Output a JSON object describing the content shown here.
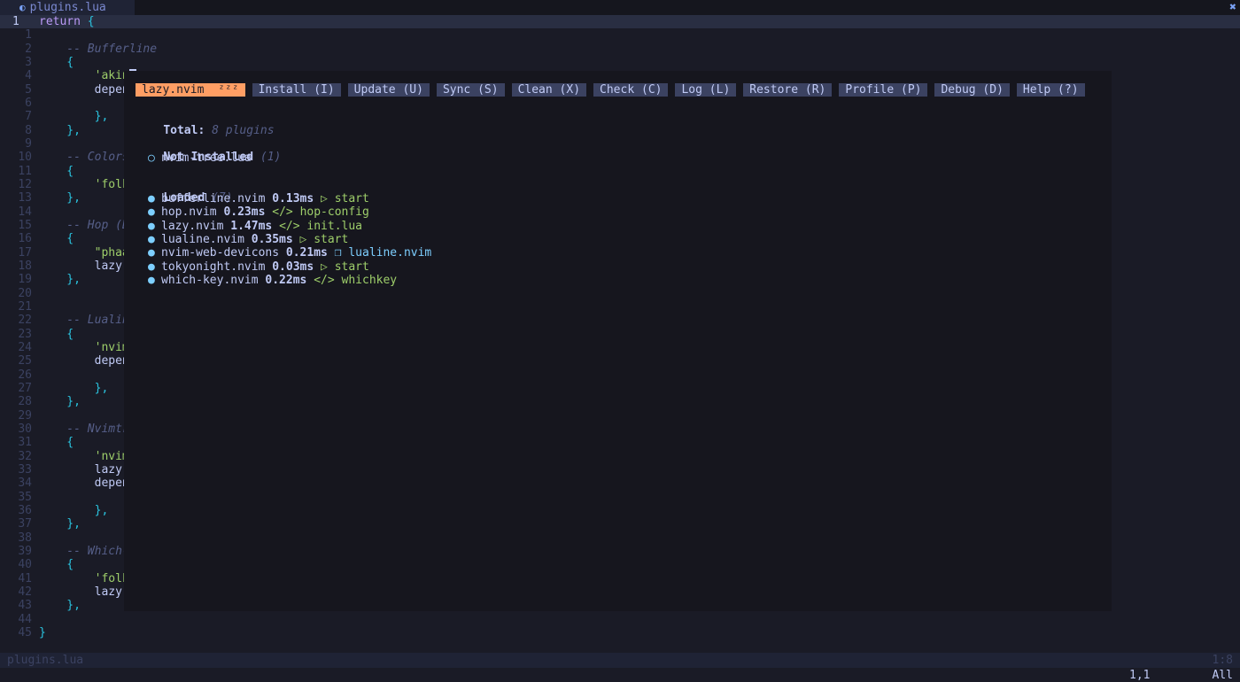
{
  "tabline": {
    "tab_label": "plugins.lua",
    "close_glyph": "✖"
  },
  "editor": {
    "lines": [
      {
        "n": "1",
        "current": true,
        "parts": [
          {
            "c": "kw",
            "t": "return "
          },
          {
            "c": "br",
            "t": "{"
          }
        ]
      },
      {
        "n": "1",
        "parts": []
      },
      {
        "n": "2",
        "parts": [
          {
            "c": "cm",
            "t": "    -- Bufferline"
          }
        ]
      },
      {
        "n": "3",
        "parts": [
          {
            "c": "br",
            "t": "    {"
          }
        ]
      },
      {
        "n": "4",
        "parts": [
          {
            "c": "st",
            "t": "        'akin"
          }
        ],
        "cursor": true
      },
      {
        "n": "5",
        "parts": [
          {
            "c": "tx",
            "t": "        depen"
          }
        ]
      },
      {
        "n": "6",
        "parts": [
          {
            "c": "st",
            "t": "            '"
          }
        ]
      },
      {
        "n": "7",
        "parts": [
          {
            "c": "br",
            "t": "        },"
          }
        ]
      },
      {
        "n": "8",
        "parts": [
          {
            "c": "br",
            "t": "    },"
          }
        ]
      },
      {
        "n": "9",
        "parts": []
      },
      {
        "n": "10",
        "parts": [
          {
            "c": "cm",
            "t": "    -- Colors"
          }
        ]
      },
      {
        "n": "11",
        "parts": [
          {
            "c": "br",
            "t": "    {"
          }
        ]
      },
      {
        "n": "12",
        "parts": [
          {
            "c": "st",
            "t": "        'folk"
          }
        ]
      },
      {
        "n": "13",
        "parts": [
          {
            "c": "br",
            "t": "    },"
          }
        ]
      },
      {
        "n": "14",
        "parts": []
      },
      {
        "n": "15",
        "parts": [
          {
            "c": "cm",
            "t": "    -- Hop (B"
          }
        ]
      },
      {
        "n": "16",
        "parts": [
          {
            "c": "br",
            "t": "    {"
          }
        ]
      },
      {
        "n": "17",
        "parts": [
          {
            "c": "st",
            "t": "        \"phaa"
          }
        ]
      },
      {
        "n": "18",
        "parts": [
          {
            "c": "tx",
            "t": "        lazy"
          }
        ]
      },
      {
        "n": "19",
        "parts": [
          {
            "c": "br",
            "t": "    },"
          }
        ]
      },
      {
        "n": "20",
        "parts": []
      },
      {
        "n": "21",
        "parts": []
      },
      {
        "n": "22",
        "parts": [
          {
            "c": "cm",
            "t": "    -- Lualin"
          }
        ]
      },
      {
        "n": "23",
        "parts": [
          {
            "c": "br",
            "t": "    {"
          }
        ]
      },
      {
        "n": "24",
        "parts": [
          {
            "c": "st",
            "t": "        'nvim"
          }
        ]
      },
      {
        "n": "25",
        "parts": [
          {
            "c": "tx",
            "t": "        depen"
          }
        ]
      },
      {
        "n": "26",
        "parts": [
          {
            "c": "st",
            "t": "            '"
          }
        ]
      },
      {
        "n": "27",
        "parts": [
          {
            "c": "br",
            "t": "        },"
          }
        ]
      },
      {
        "n": "28",
        "parts": [
          {
            "c": "br",
            "t": "    },"
          }
        ]
      },
      {
        "n": "29",
        "parts": []
      },
      {
        "n": "30",
        "parts": [
          {
            "c": "cm",
            "t": "    -- Nvimtr"
          }
        ]
      },
      {
        "n": "31",
        "parts": [
          {
            "c": "br",
            "t": "    {"
          }
        ]
      },
      {
        "n": "32",
        "parts": [
          {
            "c": "st",
            "t": "        'nvim"
          }
        ]
      },
      {
        "n": "33",
        "parts": [
          {
            "c": "tx",
            "t": "        lazy"
          }
        ]
      },
      {
        "n": "34",
        "parts": [
          {
            "c": "tx",
            "t": "        depen"
          }
        ]
      },
      {
        "n": "35",
        "parts": [
          {
            "c": "st",
            "t": "            '"
          }
        ]
      },
      {
        "n": "36",
        "parts": [
          {
            "c": "br",
            "t": "        },"
          }
        ]
      },
      {
        "n": "37",
        "parts": [
          {
            "c": "br",
            "t": "    },"
          }
        ]
      },
      {
        "n": "38",
        "parts": []
      },
      {
        "n": "39",
        "parts": [
          {
            "c": "cm",
            "t": "    -- Which-"
          }
        ]
      },
      {
        "n": "40",
        "parts": [
          {
            "c": "br",
            "t": "    {"
          }
        ]
      },
      {
        "n": "41",
        "parts": [
          {
            "c": "st",
            "t": "        'folk"
          }
        ]
      },
      {
        "n": "42",
        "parts": [
          {
            "c": "tx",
            "t": "        lazy"
          }
        ]
      },
      {
        "n": "43",
        "parts": [
          {
            "c": "br",
            "t": "    },"
          }
        ]
      },
      {
        "n": "44",
        "parts": []
      },
      {
        "n": "45",
        "parts": [
          {
            "c": "br",
            "t": "}"
          }
        ]
      }
    ]
  },
  "lazy": {
    "buttons": [
      {
        "label": "lazy.nvim  ᶻᶻᶻ",
        "active": true,
        "name": "lazy-title"
      },
      {
        "label": "Install (I)",
        "name": "install-button"
      },
      {
        "label": "Update (U)",
        "name": "update-button"
      },
      {
        "label": "Sync (S)",
        "name": "sync-button"
      },
      {
        "label": "Clean (X)",
        "name": "clean-button"
      },
      {
        "label": "Check (C)",
        "name": "check-button"
      },
      {
        "label": "Log (L)",
        "name": "log-button"
      },
      {
        "label": "Restore (R)",
        "name": "restore-button"
      },
      {
        "label": "Profile (P)",
        "name": "profile-button"
      },
      {
        "label": "Debug (D)",
        "name": "debug-button"
      },
      {
        "label": "Help (?)",
        "name": "help-button"
      }
    ],
    "total_label": "Total:",
    "total_value": "8 plugins",
    "not_installed_label": "Not Installed",
    "not_installed_count": "(1)",
    "not_installed": [
      {
        "bullet": "○",
        "name": "nvim-tree.lua"
      }
    ],
    "loaded_label": "Loaded",
    "loaded_count": "(7)",
    "loaded": [
      {
        "bullet": "●",
        "name": "bufferline.nvim",
        "time": "0.13ms",
        "icon": "▷",
        "icon_name": "play-icon",
        "source": "start",
        "source_color": "#9ece6a"
      },
      {
        "bullet": "●",
        "name": "hop.nvim",
        "time": "0.23ms",
        "icon": "</>",
        "icon_name": "code-icon",
        "source": "hop-config",
        "source_color": "#9ece6a"
      },
      {
        "bullet": "●",
        "name": "lazy.nvim",
        "time": "1.47ms",
        "icon": "</>",
        "icon_name": "code-icon",
        "source": "init.lua",
        "source_color": "#9ece6a"
      },
      {
        "bullet": "●",
        "name": "lualine.nvim",
        "time": "0.35ms",
        "icon": "▷",
        "icon_name": "play-icon",
        "source": "start",
        "source_color": "#9ece6a"
      },
      {
        "bullet": "●",
        "name": "nvim-web-devicons",
        "time": "0.21ms",
        "icon": "❒",
        "icon_name": "package-icon",
        "source": "lualine.nvim",
        "source_color": "#7dcfff"
      },
      {
        "bullet": "●",
        "name": "tokyonight.nvim",
        "time": "0.03ms",
        "icon": "▷",
        "icon_name": "play-icon",
        "source": "start",
        "source_color": "#9ece6a"
      },
      {
        "bullet": "●",
        "name": "which-key.nvim",
        "time": "0.22ms",
        "icon": "</>",
        "icon_name": "code-icon",
        "source": "whichkey",
        "source_color": "#9ece6a"
      }
    ]
  },
  "statusline": {
    "filename": "plugins.lua",
    "position": "1:8"
  },
  "cmdline": {
    "cursor_pos": "1,1",
    "scroll": "All"
  },
  "colors": {
    "background": "#1a1b26",
    "float_background": "#16161e",
    "accent": "#ff9e64",
    "button_bg": "#3b4261"
  }
}
